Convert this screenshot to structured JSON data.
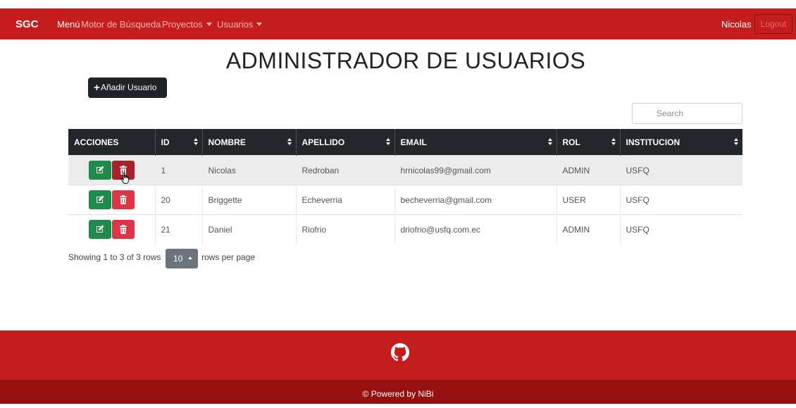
{
  "navbar": {
    "brand": "SGC",
    "items": [
      {
        "label": "Menú"
      },
      {
        "label": "Motor de Búsqueda"
      },
      {
        "label": "Proyectos"
      },
      {
        "label": "Usuarios"
      }
    ],
    "user": "Nicolas",
    "logout": "Logout"
  },
  "page": {
    "title": "ADMINISTRADOR DE USUARIOS",
    "add_button": "Añadir Usuario",
    "search_placeholder": "Search"
  },
  "table": {
    "columns": [
      "ACCIONES",
      "ID",
      "NOMBRE",
      "APELLIDO",
      "EMAIL",
      "ROL",
      "INSTITUCION"
    ],
    "rows": [
      {
        "id": "1",
        "nombre": "Nicolas",
        "apellido": "Redroban",
        "email": "hrnicolas99@gmail.com",
        "rol": "ADMIN",
        "institucion": "USFQ"
      },
      {
        "id": "20",
        "nombre": "Briggette",
        "apellido": "Echeverria",
        "email": "becheverria@gmail.com",
        "rol": "USER",
        "institucion": "USFQ"
      },
      {
        "id": "21",
        "nombre": "Daniel",
        "apellido": "Riofrio",
        "email": "driofrio@usfq.com.ec",
        "rol": "ADMIN",
        "institucion": "USFQ"
      }
    ]
  },
  "pagination": {
    "showing": "Showing 1 to 3 of 3 rows",
    "page_size": "10",
    "rows_per_page": "rows per page"
  },
  "footer": {
    "icon": "github-icon",
    "text": "© Powered by NiBi"
  },
  "colors": {
    "navbar": "#c51d1d",
    "footer_bottom": "#961010",
    "header_dark": "#23272b",
    "edit": "#1e8a4c",
    "delete": "#dc3545"
  }
}
